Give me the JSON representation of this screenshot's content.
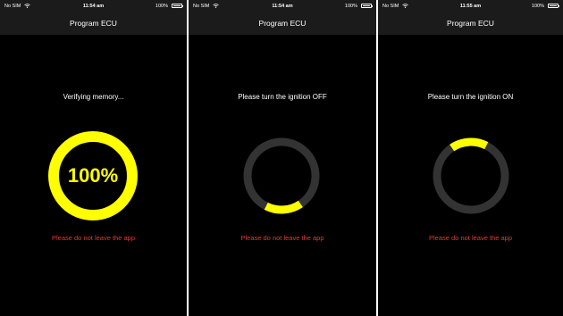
{
  "screens": [
    {
      "status": {
        "carrier": "No SIM",
        "time": "11:54 am",
        "battery": "100%"
      },
      "title": "Program ECU",
      "message": "Verifying memory...",
      "progress_text": "100%",
      "progress": {
        "type": "full",
        "fraction": 1.0
      },
      "warning": "Please do not leave the app"
    },
    {
      "status": {
        "carrier": "No SIM",
        "time": "11:54 am",
        "battery": "100%"
      },
      "title": "Program ECU",
      "message": "Please turn the ignition OFF",
      "progress": {
        "type": "arc",
        "fraction": 0.17,
        "start_angle_deg": 117
      },
      "warning": "Please do not leave the app"
    },
    {
      "status": {
        "carrier": "No SIM",
        "time": "11:55 am",
        "battery": "100%"
      },
      "title": "Program ECU",
      "message": "Please turn the ignition ON",
      "progress": {
        "type": "arc",
        "fraction": 0.17,
        "start_angle_deg": 297
      },
      "warning": "Please do not leave the app"
    }
  ],
  "colors": {
    "background": "#000000",
    "bar": "#1b1b1b",
    "accent": "#ffff00",
    "track": "#333333",
    "warning": "#e53935"
  },
  "icons": [
    "wifi-icon",
    "battery-icon"
  ]
}
